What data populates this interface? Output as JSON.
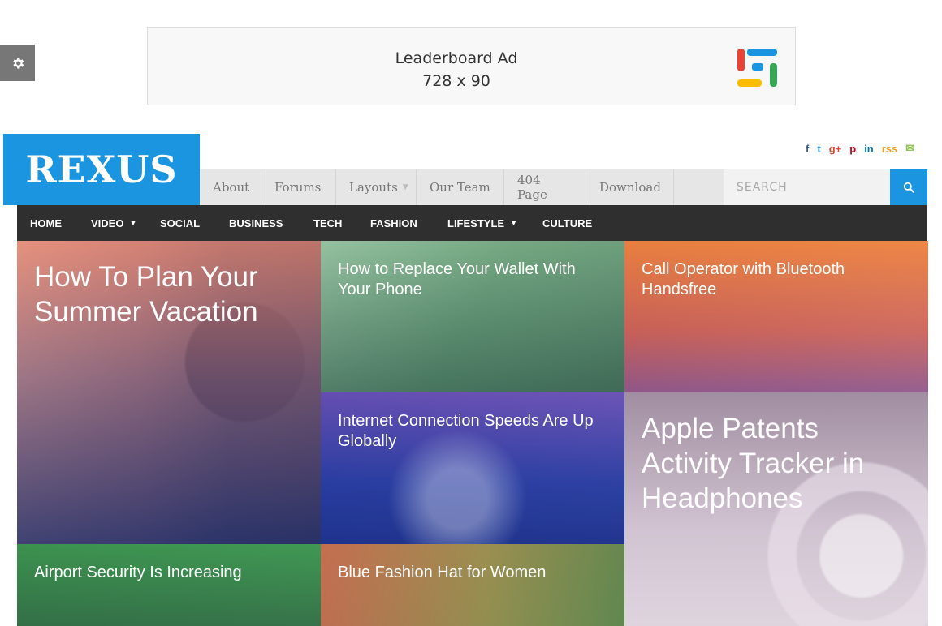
{
  "ad": {
    "line1": "Leaderboard Ad",
    "line2": "728 x 90",
    "logo_icon": "stacked-bars-logo-icon",
    "logo_colors": [
      "#ea4335",
      "#1b95e0",
      "#fbbc05",
      "#34a853"
    ]
  },
  "settings": {
    "icon": "gear-icon"
  },
  "site": {
    "logo_text": "REXUS",
    "brand_color": "#1b95e0"
  },
  "social": [
    {
      "name": "facebook-icon",
      "glyph": "f",
      "color": "#3b5998"
    },
    {
      "name": "twitter-icon",
      "glyph": "t",
      "color": "#1da1f2"
    },
    {
      "name": "google-plus-icon",
      "glyph": "g+",
      "color": "#dd4b39"
    },
    {
      "name": "pinterest-icon",
      "glyph": "p",
      "color": "#bd081c"
    },
    {
      "name": "linkedin-icon",
      "glyph": "in",
      "color": "#0077b5"
    },
    {
      "name": "rss-icon",
      "glyph": "rss",
      "color": "#f99c1c"
    },
    {
      "name": "email-icon",
      "glyph": "✉",
      "color": "#8bc34a"
    }
  ],
  "topnav": {
    "items": [
      {
        "label": "About"
      },
      {
        "label": "Forums"
      },
      {
        "label": "Layouts",
        "has_dropdown": true
      },
      {
        "label": "Our Team"
      },
      {
        "label": "404 Page"
      },
      {
        "label": "Download"
      }
    ],
    "search_placeholder": "SEARCH"
  },
  "mainnav": {
    "items": [
      {
        "label": "HOME"
      },
      {
        "label": "VIDEO",
        "has_dropdown": true
      },
      {
        "label": "SOCIAL"
      },
      {
        "label": "BUSINESS"
      },
      {
        "label": "TECH"
      },
      {
        "label": "FASHION"
      },
      {
        "label": "LIFESTYLE",
        "has_dropdown": true
      },
      {
        "label": "CULTURE"
      }
    ]
  },
  "tiles": [
    {
      "title": "How To Plan Your Summer Vacation"
    },
    {
      "title": "How to Replace Your Wallet With Your Phone"
    },
    {
      "title": "Call Operator with Bluetooth Handsfree"
    },
    {
      "title": "Internet Connection Speeds Are Up Globally"
    },
    {
      "title": "Apple Patents Activity Tracker in Headphones"
    },
    {
      "title": "Airport Security Is Increasing"
    },
    {
      "title": "Blue Fashion Hat for Women"
    }
  ]
}
